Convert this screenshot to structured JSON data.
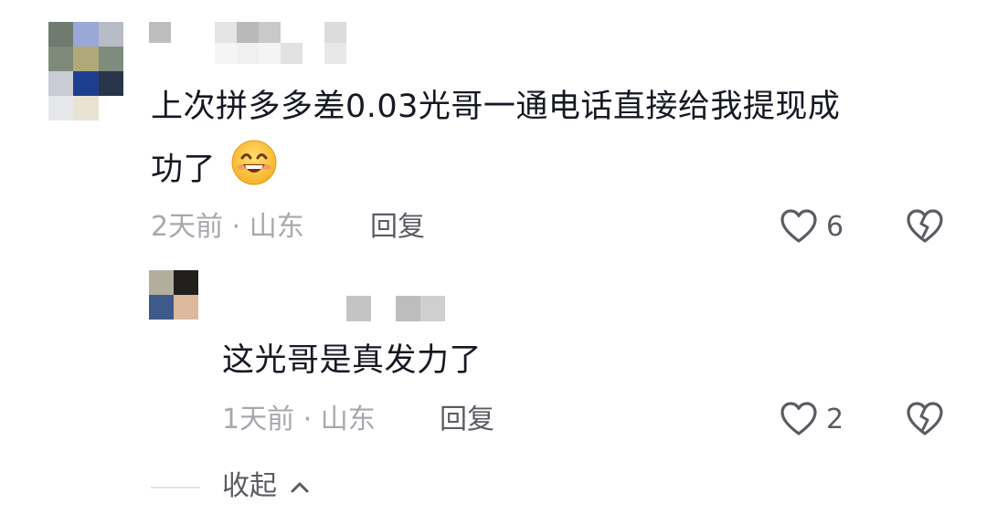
{
  "comment": {
    "text_line1": "上次拼多多差0.03光哥一通电话直接给我提现成",
    "text_line2": "功了",
    "emoji_icon": "grinning-face-emoji",
    "time_location": "2天前 · 山东",
    "reply_label": "回复",
    "like_count": "6"
  },
  "reply": {
    "text": "这光哥是真发力了",
    "time_location": "1天前 · 山东",
    "reply_label": "回复",
    "like_count": "2"
  },
  "collapse_label": "收起",
  "colors": {
    "text_primary": "#161823",
    "text_secondary": "#a7a8ad",
    "action_text": "#5b5c63",
    "icon_stroke": "#5b5c63"
  }
}
